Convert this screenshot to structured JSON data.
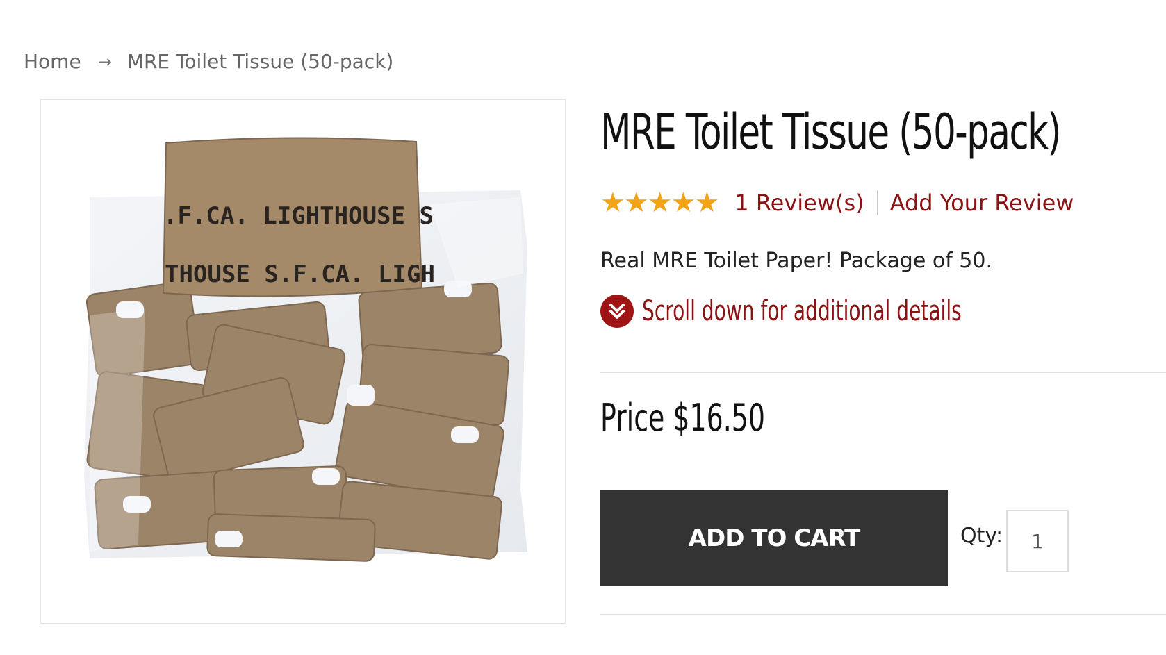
{
  "breadcrumb": {
    "home": "Home",
    "separator": "→",
    "current": "MRE Toilet Tissue (50-pack)"
  },
  "product": {
    "title": "MRE Toilet Tissue (50-pack)",
    "image_alt": "MRE Toilet Tissue (50-pack)",
    "image_text_1": ".F.CA.   LIGHTHOUSE S",
    "image_text_2": "THOUSE S.F.CA.   LIGH",
    "rating": 5,
    "rating_max": 5,
    "reviews_label": "1 Review(s)",
    "add_review_label": "Add Your Review",
    "description": "Real MRE Toilet Paper! Package of 50.",
    "scroll_label": "Scroll down for additional details",
    "price_label": "Price",
    "price": "$16.50",
    "add_to_cart_label": "ADD TO CART",
    "qty_label": "Qty:",
    "qty_value": "1"
  },
  "colors": {
    "accent": "#8a1212",
    "star": "#f3a316",
    "button": "#333333"
  },
  "icons": {
    "breadcrumb_separator": "arrow-right-icon",
    "scroll": "double-chevron-down-icon",
    "star": "star-icon"
  }
}
